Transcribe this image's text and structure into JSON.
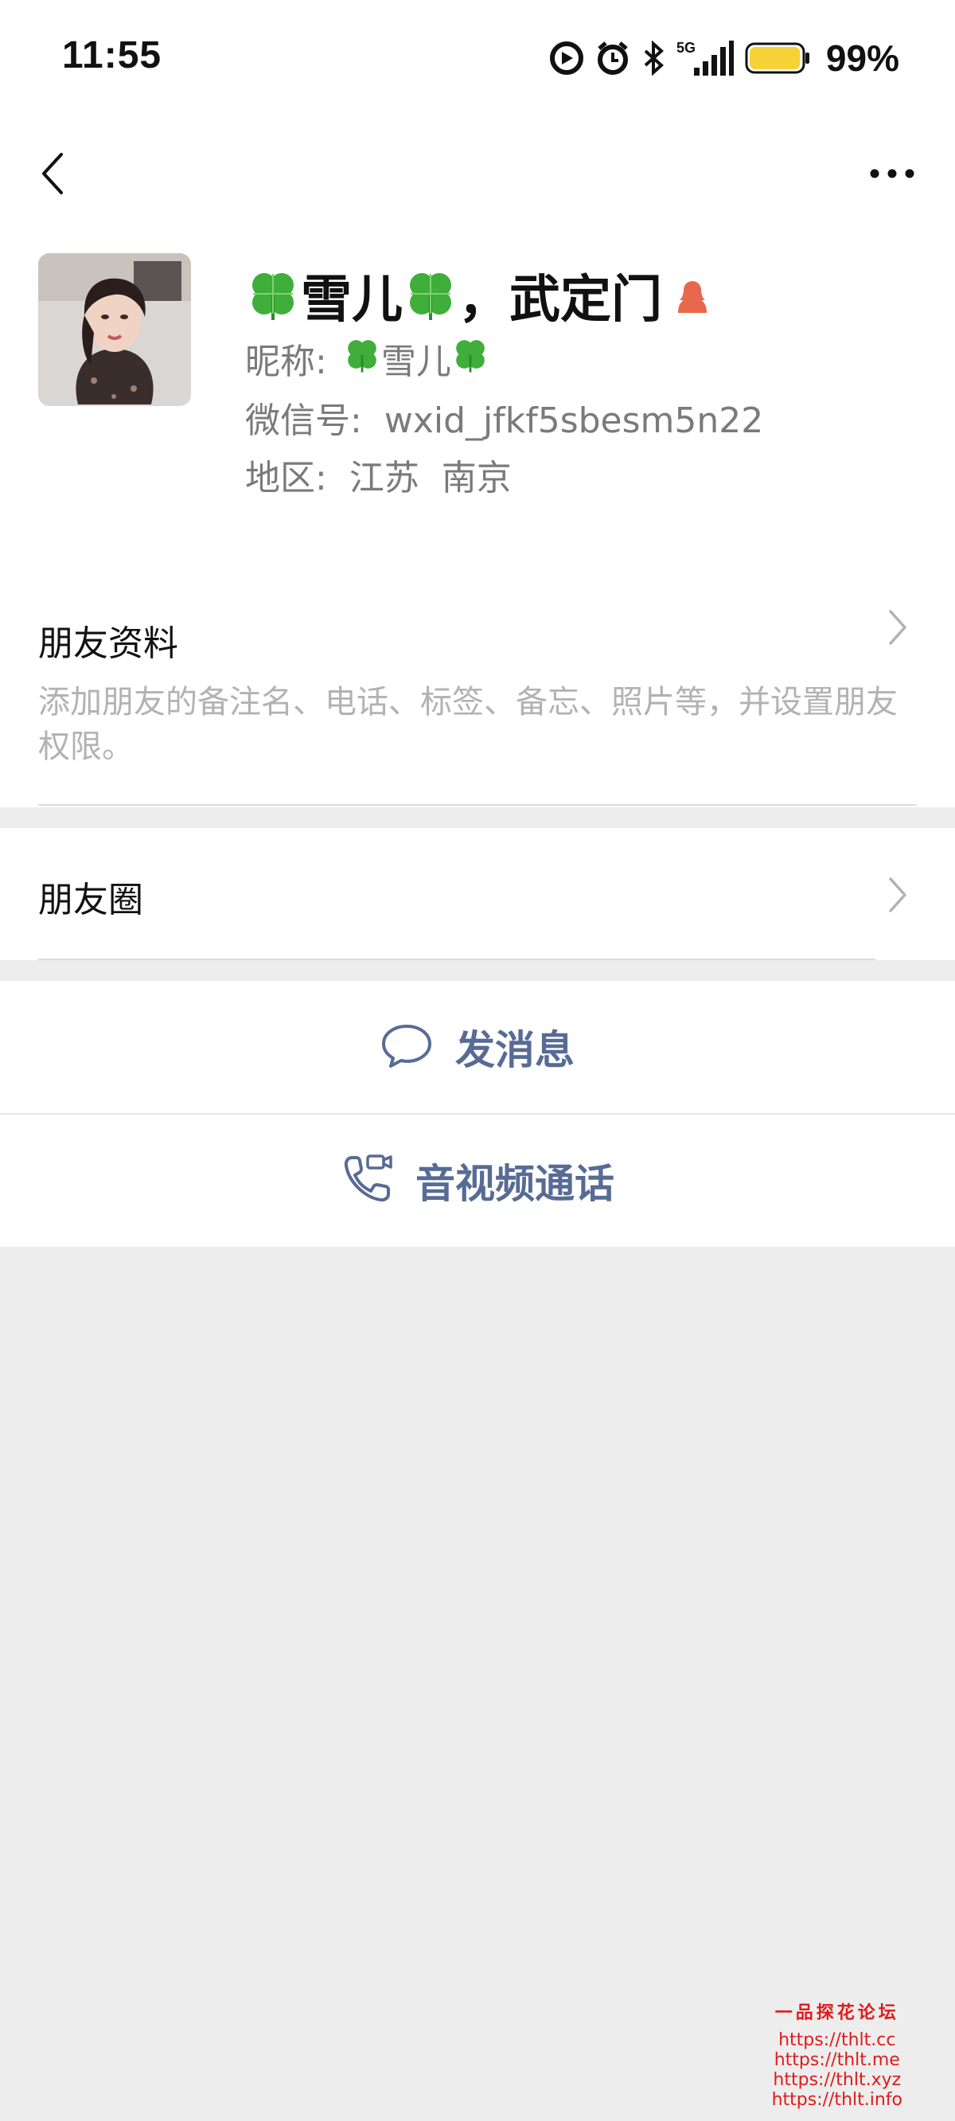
{
  "status_bar": {
    "time": "11:55",
    "network": "5G",
    "battery_percent": "99%",
    "battery_level": 0.99,
    "icons": [
      "vpn-icon",
      "alarm-icon",
      "bluetooth-icon",
      "signal-icon",
      "battery-icon"
    ]
  },
  "nav": {
    "back_icon": "chevron-left-icon",
    "more_icon": "more-dots-icon"
  },
  "profile": {
    "remark_name": "雪儿",
    "remark_suffix": "，武定门",
    "nickname_label": "昵称:",
    "nickname": "雪儿",
    "wechat_id_label": "微信号:",
    "wechat_id": "wxid_jfkf5sbesm5n22",
    "region_label": "地区:",
    "region": "江苏  南京",
    "gender": "female",
    "gender_color": "#e8684d",
    "name_decoration_icon": "four-leaf-clover-icon"
  },
  "friend_info": {
    "title": "朋友资料",
    "description": "添加朋友的备注名、电话、标签、备忘、照片等，并设置朋友权限。"
  },
  "moments": {
    "title": "朋友圈"
  },
  "actions": {
    "send_message": "发消息",
    "av_call": "音视频通话",
    "accent_color": "#576b95"
  },
  "watermark": {
    "title": "一品探花论坛",
    "links": [
      "https://thlt.cc",
      "https://thlt.me",
      "https://thlt.xyz",
      "https://thlt.info"
    ]
  }
}
